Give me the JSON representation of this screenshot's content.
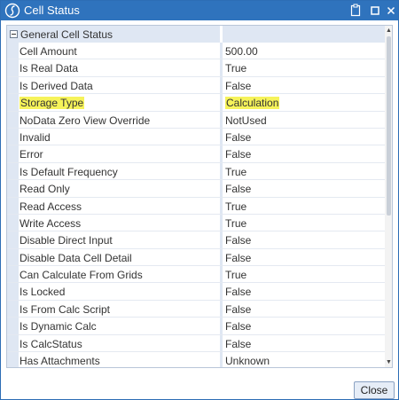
{
  "window": {
    "title": "Cell Status",
    "icons": {
      "app": "app-logo-icon",
      "clipboard": "clipboard-icon",
      "maximize": "maximize-icon",
      "close": "close-icon"
    }
  },
  "grid": {
    "category": {
      "label": "General Cell Status",
      "expander_icon": "collapse-icon"
    },
    "rows": [
      {
        "name": "Cell Amount",
        "value": "500.00"
      },
      {
        "name": "Is Real Data",
        "value": "True"
      },
      {
        "name": "Is Derived Data",
        "value": "False"
      },
      {
        "name": "Storage Type",
        "value": "Calculation",
        "highlighted": true
      },
      {
        "name": "NoData Zero View Override",
        "value": "NotUsed"
      },
      {
        "name": "Invalid",
        "value": "False"
      },
      {
        "name": "Error",
        "value": "False"
      },
      {
        "name": "Is Default Frequency",
        "value": "True"
      },
      {
        "name": "Read Only",
        "value": "False"
      },
      {
        "name": "Read Access",
        "value": "True"
      },
      {
        "name": "Write Access",
        "value": "True"
      },
      {
        "name": "Disable Direct Input",
        "value": "False"
      },
      {
        "name": "Disable Data Cell Detail",
        "value": "False"
      },
      {
        "name": "Can Calculate From Grids",
        "value": "True"
      },
      {
        "name": "Is Locked",
        "value": "False"
      },
      {
        "name": "Is From Calc Script",
        "value": "False"
      },
      {
        "name": "Is Dynamic Calc",
        "value": "False"
      },
      {
        "name": "Is CalcStatus",
        "value": "False"
      },
      {
        "name": "Has Attachments",
        "value": "Unknown"
      }
    ],
    "highlight_color": "#f6f35a"
  },
  "footer": {
    "close_label": "Close"
  },
  "colors": {
    "titlebar": "#2f73bd",
    "category_band": "#dfe7f3"
  }
}
